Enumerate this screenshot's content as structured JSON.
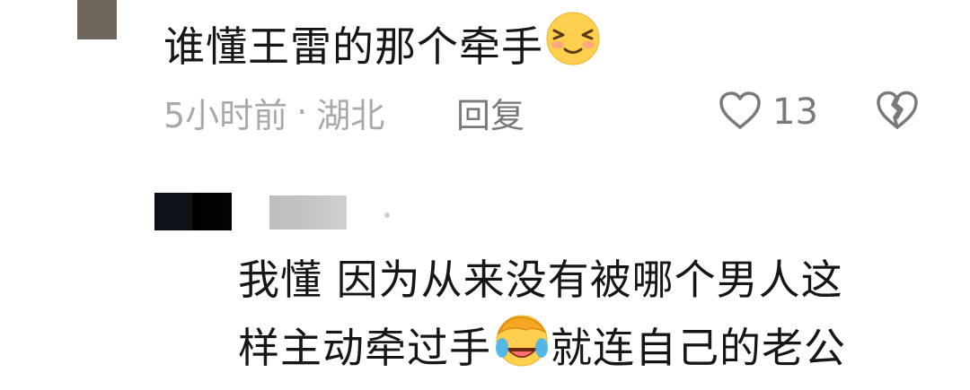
{
  "comment": {
    "text": "谁懂王雷的那个牵手",
    "emoji_icon": "shy-smile-emoji",
    "time": "5小时前",
    "separator": "·",
    "location": "湖北",
    "reply_label": "回复",
    "like_count": "13",
    "like_icon": "heart-outline-icon",
    "dislike_icon": "broken-heart-icon"
  },
  "reply": {
    "line1": "我懂 因为从来没有被哪个男人这",
    "line2_a": "样主动牵过手",
    "line2_emoji_icon": "facepalm-laugh-emoji",
    "line2_b": "就连自己的老公"
  },
  "colors": {
    "text": "#161616",
    "meta": "#a9a9a9",
    "action": "#7a7a7a",
    "background": "#ffffff"
  }
}
